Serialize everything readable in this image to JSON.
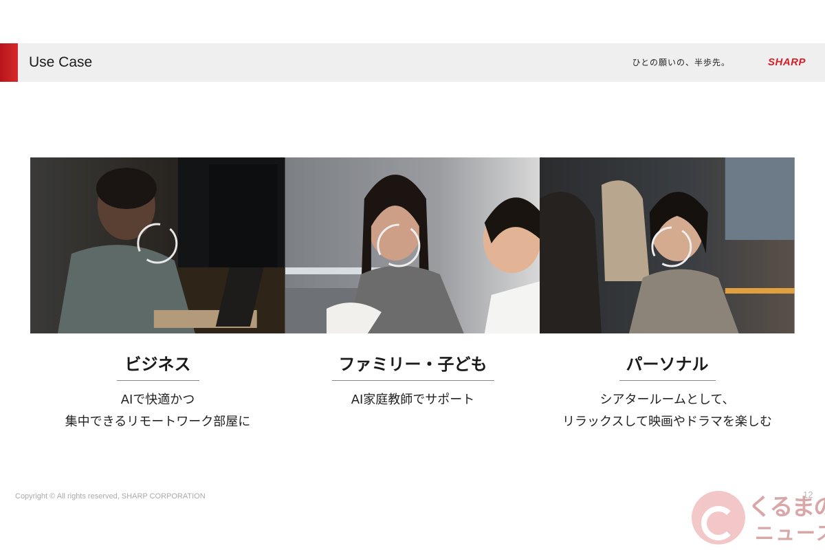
{
  "header": {
    "title": "Use Case",
    "tagline": "ひとの願いの、半歩先。",
    "logo": "SHARP",
    "accent_color": "#c8191f"
  },
  "use_cases": [
    {
      "title": "ビジネス",
      "description_lines": [
        "AIで快適かつ",
        "集中できるリモートワーク部屋に"
      ]
    },
    {
      "title": "ファミリー・子ども",
      "description_lines": [
        "AI家庭教師でサポート"
      ]
    },
    {
      "title": "パーソナル",
      "description_lines": [
        "シアタールームとして、",
        "リラックスして映画やドラマを楽しむ"
      ]
    }
  ],
  "footer": {
    "copyright": "Copyright © All rights reserved, SHARP CORPORATION",
    "page_number": "12"
  },
  "watermark": {
    "line1": "くるまの",
    "line2": "ニュース"
  }
}
